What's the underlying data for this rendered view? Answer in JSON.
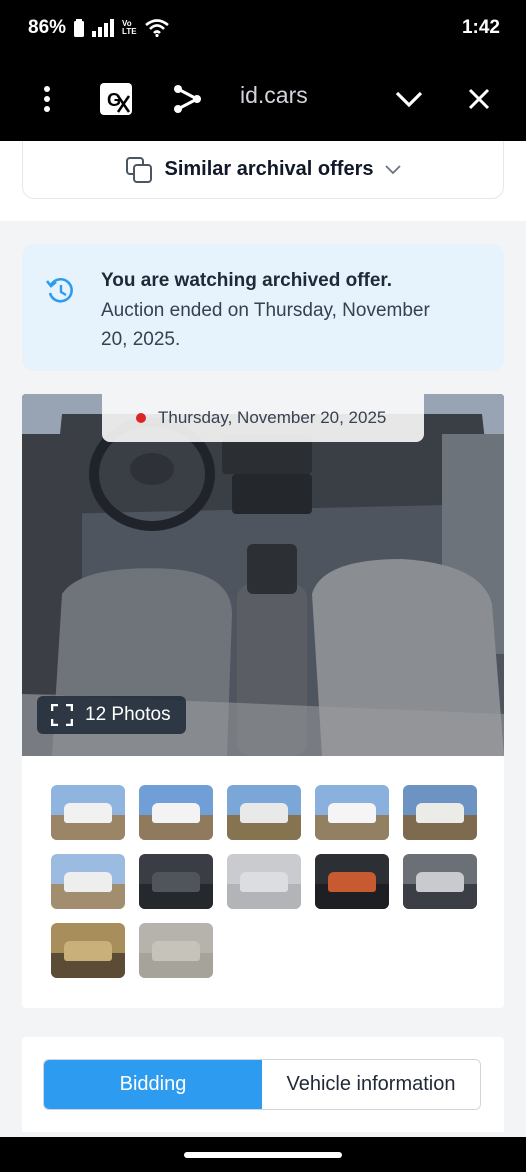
{
  "status_bar": {
    "battery_percent": "86%",
    "volte_label_top": "Vo",
    "volte_label_bottom": "LTE",
    "time": "1:42"
  },
  "browser": {
    "url_text": "id.cars",
    "icons": [
      "more-vert-icon",
      "translate-icon",
      "share-icon",
      "chevron-down-icon",
      "close-icon"
    ]
  },
  "similar_offers": {
    "label": "Similar archival offers"
  },
  "archive_notice": {
    "title": "You are watching archived offer.",
    "text": "Auction ended on Thursday, November 20, 2025."
  },
  "gallery": {
    "date": "Thursday, November 20, 2025",
    "photos_label": "12 Photos",
    "thumbnails": [
      {
        "sky": "#8fb4e0",
        "ground": "#9b8566",
        "car": "#f1f1f1"
      },
      {
        "sky": "#6f9fd6",
        "ground": "#8f7a5d",
        "car": "#f3f3f3"
      },
      {
        "sky": "#7aa6d8",
        "ground": "#86734f",
        "car": "#e9e9e9"
      },
      {
        "sky": "#8ab1dd",
        "ground": "#938062",
        "car": "#f5f5f5"
      },
      {
        "sky": "#6c93c2",
        "ground": "#7e6a4f",
        "car": "#ebebe8"
      },
      {
        "sky": "#9bbbe0",
        "ground": "#a28e6e",
        "car": "#eeeeee"
      },
      {
        "sky": "#3a3e44",
        "ground": "#25282c",
        "car": "#50555c"
      },
      {
        "sky": "#c9cbcf",
        "ground": "#b2b4b7",
        "car": "#dcdde0"
      },
      {
        "sky": "#2c2f33",
        "ground": "#1d1f22",
        "car": "#c85a32"
      },
      {
        "sky": "#6b6f76",
        "ground": "#3b3f45",
        "car": "#c9cace"
      },
      {
        "sky": "#a88e5a",
        "ground": "#5c4c35",
        "car": "#c9b07a"
      },
      {
        "sky": "#b5b3ab",
        "ground": "#a6a39a",
        "car": "#c6c3bb"
      }
    ]
  },
  "tabs": [
    {
      "label": "Bidding",
      "active": true
    },
    {
      "label": "Vehicle information",
      "active": false
    }
  ],
  "colors": {
    "accent": "#2d9cf0",
    "notice_bg": "#e6f2fc",
    "status_dot": "#dc2626"
  }
}
